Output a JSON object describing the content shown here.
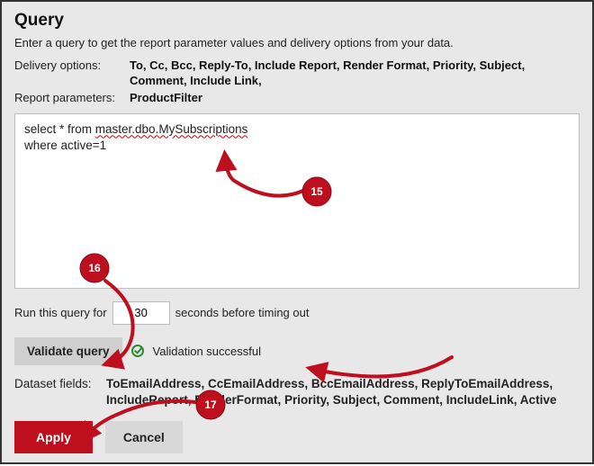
{
  "title": "Query",
  "description": "Enter a query to get the report parameter values and delivery options from your data.",
  "deliveryOptions": {
    "label": "Delivery options:",
    "value": "To, Cc, Bcc, Reply-To, Include Report, Render Format, Priority, Subject, Comment, Include Link,"
  },
  "reportParameters": {
    "label": "Report parameters:",
    "value": "ProductFilter"
  },
  "query": {
    "line1_prefix": "select * from ",
    "line1_squiggle": "master.dbo.MySubscriptions",
    "line2": "where active=1"
  },
  "timeout": {
    "prefix": "Run this query for",
    "value": "30",
    "suffix": "seconds before timing out"
  },
  "validate": {
    "button": "Validate query",
    "message": "Validation successful"
  },
  "dataset": {
    "label": "Dataset fields:",
    "value": "ToEmailAddress, CcEmailAddress, BccEmailAddress, ReplyToEmailAddress, IncludeReport, RenderFormat, Priority, Subject, Comment, IncludeLink, Active"
  },
  "buttons": {
    "apply": "Apply",
    "cancel": "Cancel"
  },
  "annotations": {
    "b15": "15",
    "b16": "16",
    "b17": "17"
  }
}
